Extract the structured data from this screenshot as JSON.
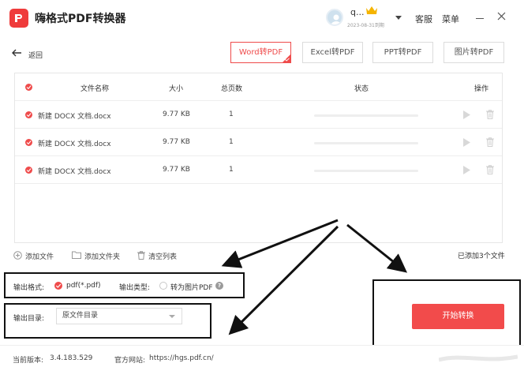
{
  "app": {
    "title": "嗨格式PDF转换器"
  },
  "user": {
    "name": "q...",
    "expire": "2023-08-31到期"
  },
  "menu": {
    "service": "客服",
    "menu": "菜单"
  },
  "nav": {
    "back": "返回"
  },
  "tabs": [
    {
      "label": "Word转PDF",
      "active": true
    },
    {
      "label": "Excel转PDF",
      "active": false
    },
    {
      "label": "PPT转PDF",
      "active": false
    },
    {
      "label": "图片转PDF",
      "active": false
    }
  ],
  "table": {
    "headers": {
      "name": "文件名称",
      "size": "大小",
      "pages": "总页数",
      "status": "状态",
      "ops": "操作"
    },
    "rows": [
      {
        "name": "新建 DOCX 文档.docx",
        "size": "9.77 KB",
        "pages": "1"
      },
      {
        "name": "新建 DOCX 文档.docx",
        "size": "9.77 KB",
        "pages": "1"
      },
      {
        "name": "新建 DOCX 文档.docx",
        "size": "9.77 KB",
        "pages": "1"
      }
    ]
  },
  "actions": {
    "add_file": "添加文件",
    "add_folder": "添加文件夹",
    "clear": "清空列表",
    "count": "已添加3个文件"
  },
  "options": {
    "format_label": "输出格式:",
    "format_value": "pdf(*.pdf)",
    "type_label": "输出类型:",
    "type_value": "转为图片PDF",
    "dir_label": "输出目录:",
    "dir_value": "原文件目录"
  },
  "start": "开始转换",
  "footer": {
    "version_label": "当前版本:",
    "version": "3.4.183.529",
    "site_label": "官方网站:",
    "site": "https://hgs.pdf.cn/"
  },
  "colors": {
    "accent": "#f24b4b"
  }
}
